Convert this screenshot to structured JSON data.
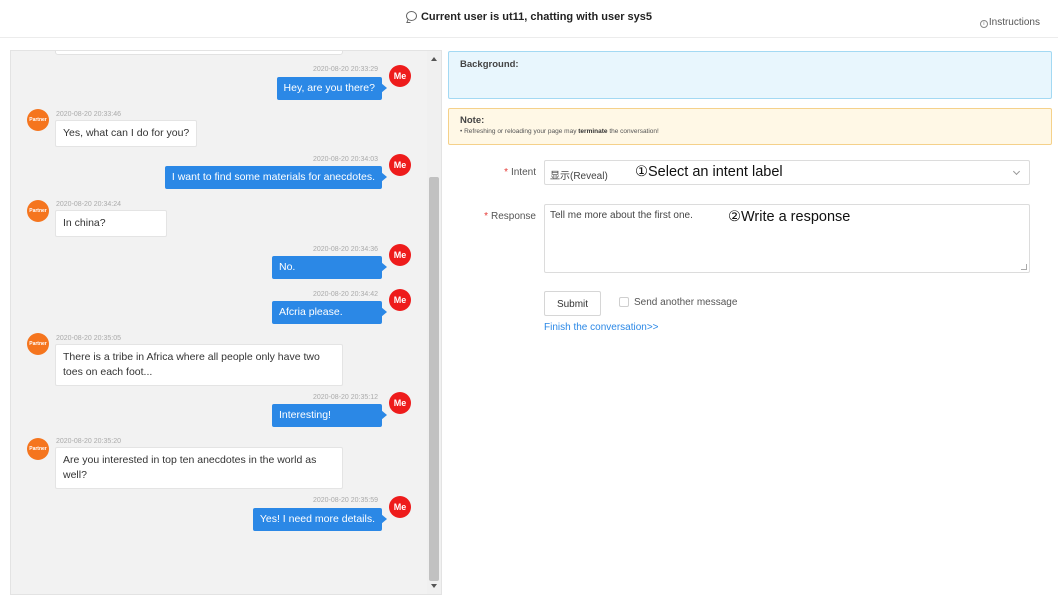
{
  "header": {
    "title": "Current user is ut11, chatting with user sys5",
    "instructions": "Instructions"
  },
  "chat": {
    "me_avatar": "Me",
    "partner_avatar": "Partner",
    "messages": [
      {
        "sender": "me",
        "time": "2020-08-20 20:33:29",
        "text": "Hey, are you there?"
      },
      {
        "sender": "partner",
        "time": "2020-08-20 20:33:46",
        "text": "Yes, what can I do for you?"
      },
      {
        "sender": "me",
        "time": "2020-08-20 20:34:03",
        "text": "I want to find some materials for anecdotes."
      },
      {
        "sender": "partner",
        "time": "2020-08-20 20:34:24",
        "text": "In china?"
      },
      {
        "sender": "me",
        "time": "2020-08-20 20:34:36",
        "text": "No."
      },
      {
        "sender": "me",
        "time": "2020-08-20 20:34:42",
        "text": "Afcria please."
      },
      {
        "sender": "partner",
        "time": "2020-08-20 20:35:05",
        "text": "There is a tribe in Africa where all people only have two toes on each foot..."
      },
      {
        "sender": "me",
        "time": "2020-08-20 20:35:12",
        "text": "Interesting!"
      },
      {
        "sender": "partner",
        "time": "2020-08-20 20:35:20",
        "text": "Are you interested in top ten anecdotes in the world as well?"
      },
      {
        "sender": "me",
        "time": "2020-08-20 20:35:59",
        "text": "Yes! I need more details."
      }
    ]
  },
  "background_box": {
    "label": "Background:"
  },
  "note_box": {
    "label": "Note:",
    "text_prefix": "• Refreshing or reloading your page may ",
    "text_bold": "terminate",
    "text_suffix": " the conversation!"
  },
  "form": {
    "required_mark": "*",
    "intent_label": "Intent",
    "intent_value": "显示(Reveal)",
    "intent_annotation": "①Select an intent label",
    "response_label": "Response",
    "response_value": "Tell me more about the first one.",
    "response_annotation": "②Write a response",
    "submit_label": "Submit",
    "send_another_label": "Send another message",
    "send_another_checked": false,
    "finish_link": "Finish the conversation>>"
  },
  "colors": {
    "me_bubble": "#2b88e6",
    "me_avatar": "#ee1c1c",
    "partner_avatar": "#f5751e",
    "link": "#2b88e6"
  }
}
